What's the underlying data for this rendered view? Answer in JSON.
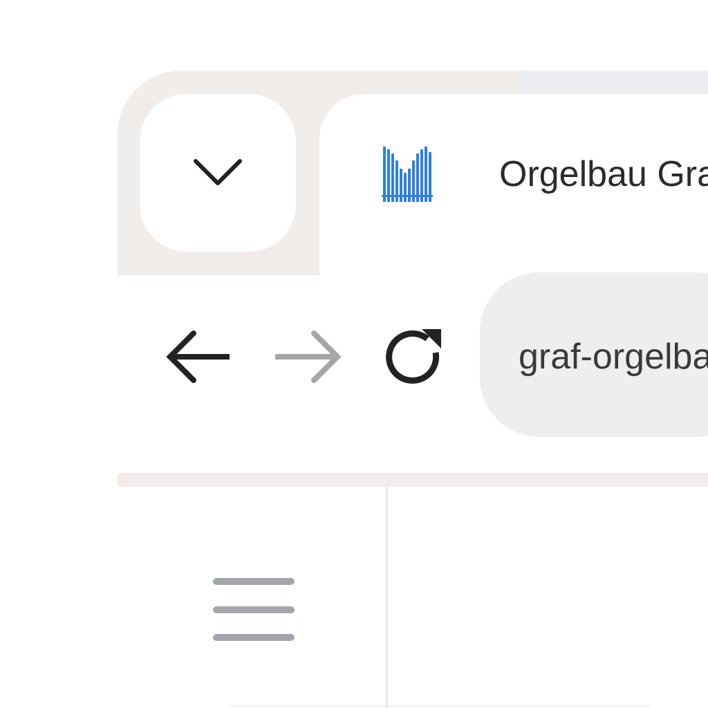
{
  "tab": {
    "title": "Orgelbau Graf",
    "favicon": "organ-pipes-icon"
  },
  "toolbar": {
    "back_icon": "arrow-left-icon",
    "forward_icon": "arrow-right-icon",
    "reload_icon": "reload-icon",
    "url": "graf-orgelbau"
  },
  "page": {
    "menu_icon": "hamburger-menu-icon"
  },
  "colors": {
    "tab_strip": "#f0edea",
    "favicon_blue": "#2f7fe0",
    "icon_dark": "#222222",
    "icon_disabled": "#a6a6a6",
    "omnibox_bg": "#eeeeee",
    "menu_gray": "#a3a7ac"
  }
}
